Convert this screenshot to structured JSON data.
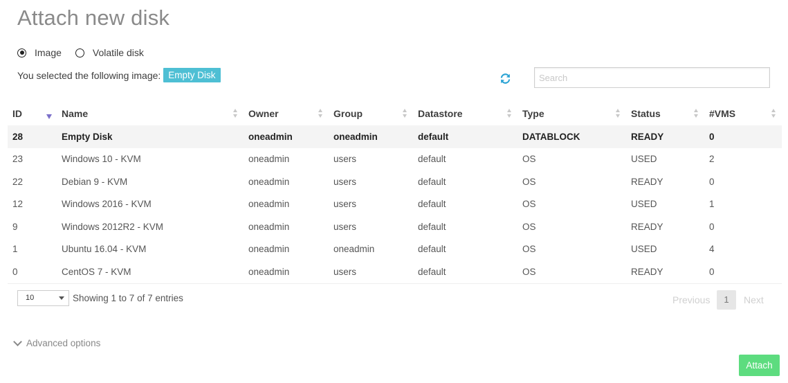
{
  "title": "Attach new disk",
  "radios": [
    {
      "label": "Image",
      "checked": true
    },
    {
      "label": "Volatile disk",
      "checked": false
    }
  ],
  "selected_text": "You selected the following image:",
  "selected_image": "Empty Disk",
  "search": {
    "placeholder": "Search",
    "value": ""
  },
  "table": {
    "columns": [
      "ID",
      "Name",
      "Owner",
      "Group",
      "Datastore",
      "Type",
      "Status",
      "#VMS"
    ],
    "rows": [
      [
        "28",
        "Empty Disk",
        "oneadmin",
        "oneadmin",
        "default",
        "DATABLOCK",
        "READY",
        "0"
      ],
      [
        "23",
        "Windows 10 - KVM",
        "oneadmin",
        "users",
        "default",
        "OS",
        "USED",
        "2"
      ],
      [
        "22",
        "Debian 9 - KVM",
        "oneadmin",
        "users",
        "default",
        "OS",
        "READY",
        "0"
      ],
      [
        "12",
        "Windows 2016 - KVM",
        "oneadmin",
        "users",
        "default",
        "OS",
        "USED",
        "1"
      ],
      [
        "9",
        "Windows 2012R2 - KVM",
        "oneadmin",
        "users",
        "default",
        "OS",
        "READY",
        "0"
      ],
      [
        "1",
        "Ubuntu 16.04 - KVM",
        "oneadmin",
        "oneadmin",
        "default",
        "OS",
        "USED",
        "4"
      ],
      [
        "0",
        "CentOS 7 - KVM",
        "oneadmin",
        "users",
        "default",
        "OS",
        "READY",
        "0"
      ]
    ],
    "selected_row": 0
  },
  "page_length": "10",
  "info": "Showing 1 to 7 of 7 entries",
  "pagination": {
    "previous": "Previous",
    "current": "1",
    "next": "Next"
  },
  "advanced_label": "Advanced options",
  "attach_label": "Attach",
  "colors": {
    "badge": "#4ebfd4",
    "attach": "#5ddc7f",
    "refresh": "#2aa3d4",
    "sort_active": "#7b6fc9"
  }
}
